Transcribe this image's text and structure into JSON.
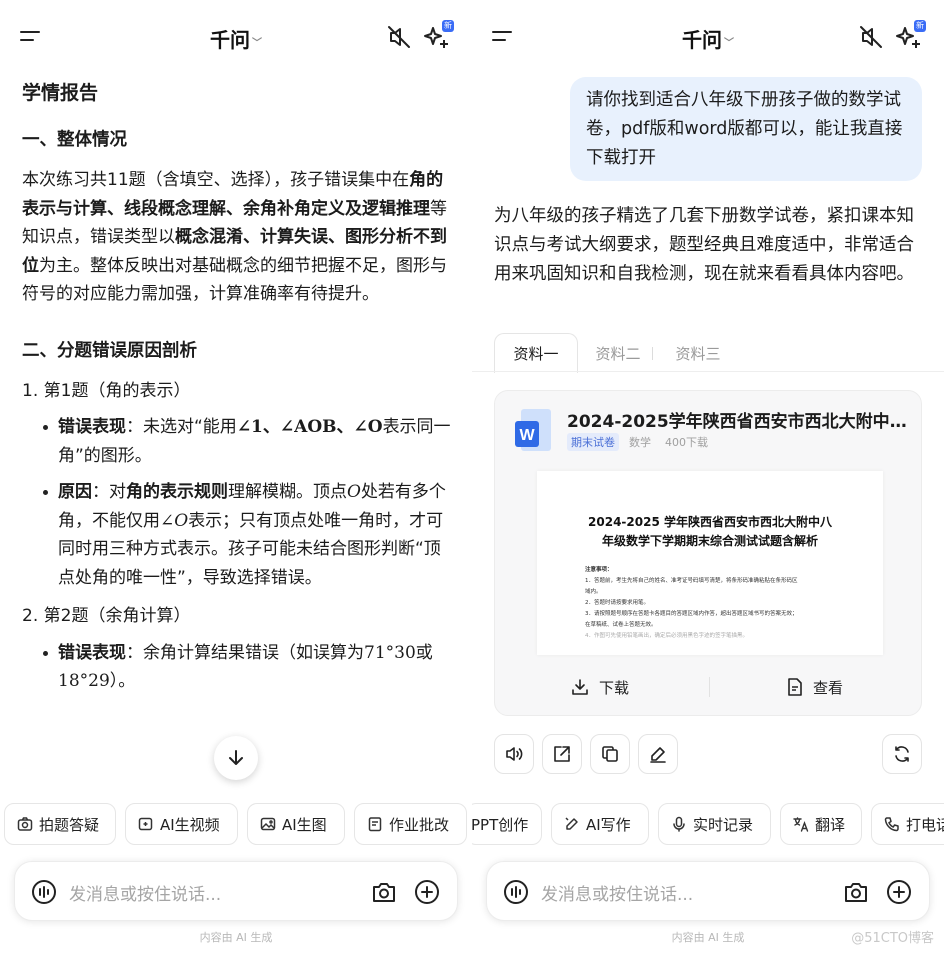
{
  "left": {
    "header": {
      "title": "千问",
      "badge": "新"
    },
    "report": {
      "title": "学情报告",
      "sec1_heading": "一、整体情况",
      "sec1_p1_a": "本次练习共11题（含填空、选择），孩子错误集中在",
      "sec1_p1_b": "角的表示与计算、线段概念理解、余角补角定义及逻辑推理",
      "sec1_p1_c": "等知识点，错误类型以",
      "sec1_p1_d": "概念混淆、计算失误、图形分析不到位",
      "sec1_p1_e": "为主。整体反映出对基础概念的细节把握不足，图形与符号的对应能力需加强，计算准确率有待提升。",
      "sec2_heading": "二、分题错误原因剖析",
      "q1_title": "1. 第1题（角的表示）",
      "q1_err_label": "错误表现",
      "q1_err_a": "：未选对“能用",
      "q1_err_math": "∠1、∠AOB、∠O",
      "q1_err_b": "表示同一角”的图形。",
      "q1_cause_label": "原因",
      "q1_cause_a": "：对",
      "q1_cause_bold": "角的表示规则",
      "q1_cause_b": "理解模糊。顶点",
      "q1_cause_m1": "O",
      "q1_cause_c": "处若有多个角，不能仅用",
      "q1_cause_m2": "∠O",
      "q1_cause_d": "表示；只有顶点处唯一角时，才可同时用三种方式表示。孩子可能未结合图形判断“顶点处角的唯一性”，导致选择错误。",
      "q2_title": "2. 第2题（余角计算）",
      "q2_err_label": "错误表现",
      "q2_err_a": "：余角计算结果错误（如误算为",
      "q2_err_m1": "71°30",
      "q2_err_b": "或",
      "q2_err_m2": "18°29",
      "q2_err_c": "）。"
    },
    "chips": [
      "拍题答疑",
      "AI生视频",
      "AI生图",
      "作业批改"
    ],
    "input_placeholder": "发消息或按住说话...",
    "disclaimer": "内容由 AI 生成"
  },
  "right": {
    "header": {
      "title": "千问",
      "badge": "新"
    },
    "user_message": "请你找到适合八年级下册孩子做的数学试卷，pdf版和word版都可以，能让我直接下载打开",
    "answer": "为八年级的孩子精选了几套下册数学试卷，紧扣课本知识点与考试大纲要求，题型经典且难度适中，非常适合用来巩固知识和自我检测，现在就来看看具体内容吧。",
    "tabs": [
      "资料一",
      "资料二",
      "资料三"
    ],
    "doc": {
      "title": "2024-2025学年陕西省西安市西北大附中八年级数学下学期期末综合测试试题含解析",
      "tag": "期末试卷",
      "subject": "数学",
      "downloads": "400下载",
      "preview_title_1": "2024-2025 学年陕西省西安市西北大附中八",
      "preview_title_2": "年级数学下学期期末综合测试试题含解析",
      "preview_lines": [
        "注意事项：",
        "1．答题前，考生先将自己的姓名、准考证号码填写清楚，将条形码准确粘贴在条形码区",
        "域内。",
        "2．答题时请按要求用笔。",
        "3．请按照题号顺序在答题卡各题目的答题区域内作答，超出答题区域书写的答案无效；",
        "在草稿纸、试卷上答题无效。",
        "4．作图可先使用铅笔画出，确定后必须用黑色字迹的签字笔描黑。"
      ],
      "download_label": "下载",
      "view_label": "查看"
    },
    "chips": [
      "PPT创作",
      "AI写作",
      "实时记录",
      "翻译",
      "打电话"
    ],
    "input_placeholder": "发消息或按住说话...",
    "disclaimer": "内容由 AI 生成",
    "watermark": "@51CTO博客"
  }
}
